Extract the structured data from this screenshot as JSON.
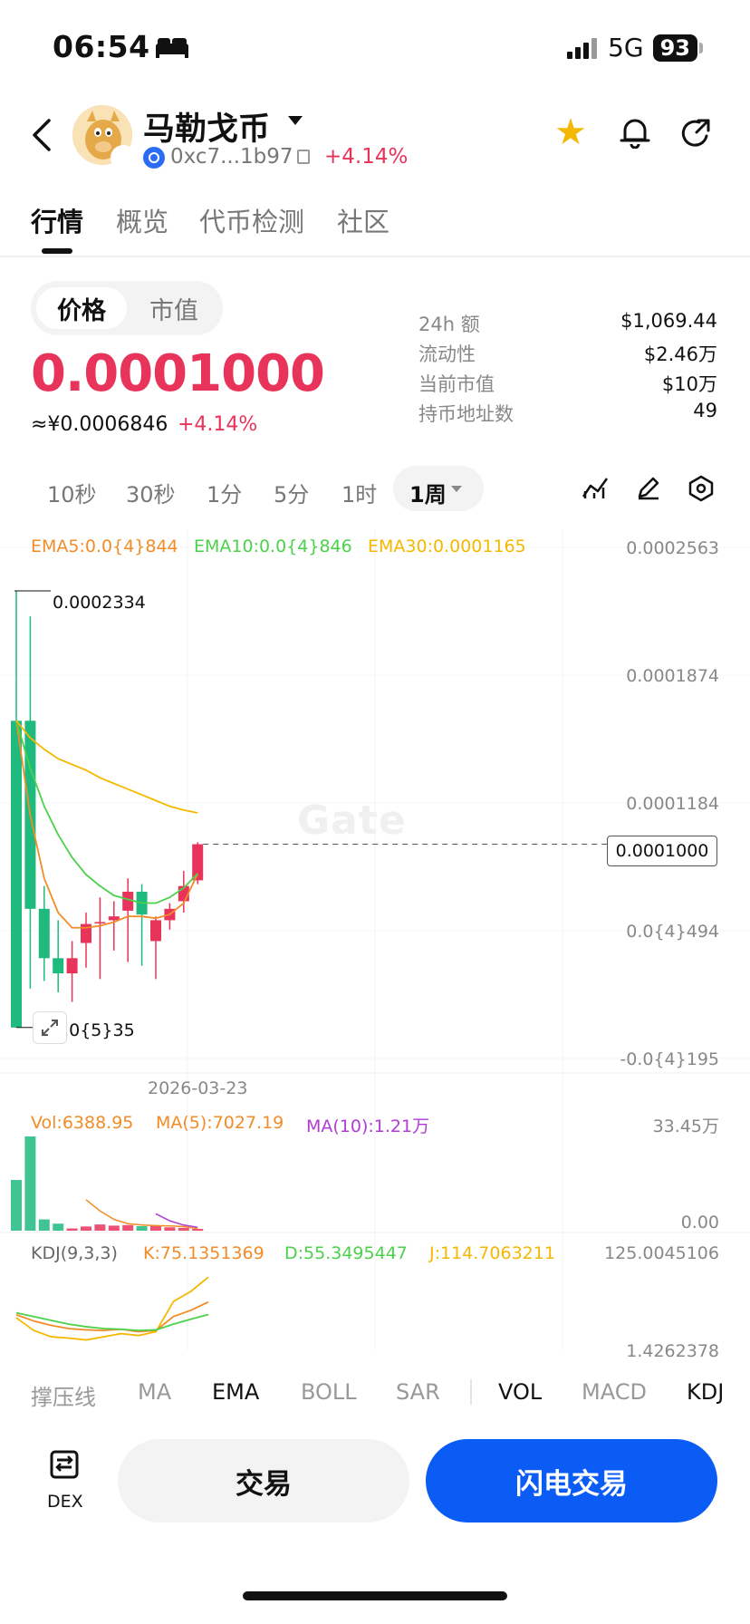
{
  "status_bar": {
    "time": "06:54",
    "network": "5G",
    "battery": "93"
  },
  "header": {
    "coin_name": "马勒戈币",
    "address": "0xc7...1b97",
    "change": "+4.14%"
  },
  "tabs": [
    "行情",
    "概览",
    "代币检测",
    "社区"
  ],
  "price_toggle": {
    "price": "价格",
    "market_cap": "市值"
  },
  "price": {
    "main": "0.0001000",
    "cny": "≈¥0.0006846",
    "change": "+4.14%"
  },
  "stats": [
    {
      "label": "24h  额",
      "value": "$1,069.44"
    },
    {
      "label": "流动性",
      "value": "$2.46万"
    },
    {
      "label": "当前市值",
      "value": "$10万"
    },
    {
      "label": "持币地址数",
      "value": "49"
    }
  ],
  "timeframes": [
    "10秒",
    "30秒",
    "1分",
    "5分",
    "1时"
  ],
  "active_timeframe": "1周",
  "chart": {
    "watermark": "Gate",
    "ema": {
      "ema5": "EMA5:0.0{4}844",
      "ema10": "EMA10:0.0{4}846",
      "ema30": "EMA30:0.0001165"
    },
    "y_axis": [
      "0.0002563",
      "0.0001874",
      "0.0001184",
      "0.0{4}494",
      "-0.0{4}195"
    ],
    "current_price_tag": "0.0001000",
    "high_label": "0.0002334",
    "low_label": "0.0{5}35",
    "date_label": "2026-03-23",
    "volume": {
      "vol": "Vol:6388.95",
      "ma5": "MA(5):7027.19",
      "ma10": "MA(10):1.21万",
      "axis_top": "33.45万",
      "axis_bottom": "0.00"
    },
    "kdj": {
      "title": "KDJ(9,3,3)",
      "k": "K:75.1351369",
      "d": "D:55.3495447",
      "j": "J:114.7063211",
      "axis_top": "125.0045106",
      "axis_bottom": "1.4262378"
    },
    "colors": {
      "up": "#e8345a",
      "down": "#1fba7e",
      "ema5": "#f28c28",
      "ema10": "#4cd14c",
      "ema30": "#f5b800",
      "ma10": "#b23bd6"
    }
  },
  "chart_data": {
    "type": "candlestick",
    "title": "",
    "ylabel": "",
    "xlabel": "",
    "ylim": [
      -1.95e-05,
      0.0002563
    ],
    "candles": [
      {
        "open": 0.000165,
        "high": 0.0002334,
        "low": 3.5e-06,
        "close": 3.5e-06
      },
      {
        "open": 0.000165,
        "high": 0.00022,
        "low": 2.4e-05,
        "close": 6.6e-05
      },
      {
        "open": 6.6e-05,
        "high": 7.8e-05,
        "low": 2.8e-05,
        "close": 4e-05
      },
      {
        "open": 4e-05,
        "high": 6e-05,
        "low": 2.2e-05,
        "close": 3.2e-05
      },
      {
        "open": 3.2e-05,
        "high": 4.9e-05,
        "low": 1.7e-05,
        "close": 4e-05
      },
      {
        "open": 4.8e-05,
        "high": 6.4e-05,
        "low": 3.5e-05,
        "close": 5.8e-05
      },
      {
        "open": 5.9e-05,
        "high": 7.2e-05,
        "low": 2.9e-05,
        "close": 5.9e-05
      },
      {
        "open": 6e-05,
        "high": 7e-05,
        "low": 4.4e-05,
        "close": 6.2e-05
      },
      {
        "open": 6.5e-05,
        "high": 8.2e-05,
        "low": 3.8e-05,
        "close": 7.5e-05
      },
      {
        "open": 7.5e-05,
        "high": 7.9e-05,
        "low": 3.6e-05,
        "close": 6.3e-05
      },
      {
        "open": 4.9e-05,
        "high": 6.2e-05,
        "low": 2.9e-05,
        "close": 6e-05
      },
      {
        "open": 6e-05,
        "high": 6.9e-05,
        "low": 5.5e-05,
        "close": 6.6e-05
      },
      {
        "open": 7e-05,
        "high": 8.6e-05,
        "low": 6.4e-05,
        "close": 7.8e-05
      },
      {
        "open": 8.1e-05,
        "high": 0.000101,
        "low": 7.9e-05,
        "close": 0.0001
      }
    ],
    "series": [
      {
        "name": "EMA5",
        "values": [
          0.000165,
          0.000115,
          8.2e-05,
          6.4e-05,
          5.6e-05,
          5.6e-05,
          5.7e-05,
          5.9e-05,
          6.2e-05,
          6.2e-05,
          6.1e-05,
          6.3e-05,
          6.9e-05,
          8.44e-05
        ]
      },
      {
        "name": "EMA10",
        "values": [
          0.000165,
          0.00014,
          0.00012,
          0.000105,
          9.3e-05,
          8.4e-05,
          7.8e-05,
          7.3e-05,
          7.1e-05,
          6.9e-05,
          6.9e-05,
          7.2e-05,
          7.7e-05,
          8.46e-05
        ]
      },
      {
        "name": "EMA30",
        "values": [
          0.000165,
          0.000156,
          0.00015,
          0.000145,
          0.000142,
          0.000139,
          0.000135,
          0.000132,
          0.000129,
          0.000126,
          0.000123,
          0.00012,
          0.000118,
          0.0001165
        ]
      }
    ],
    "volume": [
      180000,
      334500,
      40000,
      25000,
      8000,
      15000,
      22000,
      18000,
      20000,
      16000,
      19000,
      12000,
      10000,
      6388.95
    ],
    "vol_ma5": [
      null,
      null,
      null,
      null,
      null,
      110000,
      70000,
      40000,
      25000,
      20000,
      18000,
      17000,
      15000,
      7027.19
    ],
    "vol_ma10": [
      null,
      null,
      null,
      null,
      null,
      null,
      null,
      null,
      null,
      null,
      60000,
      35000,
      20000,
      12100
    ],
    "kdj_ylim": [
      1.4262378,
      125.0045106
    ],
    "kdj": {
      "k": [
        55,
        45,
        38,
        33,
        31,
        30,
        32,
        28,
        30,
        52,
        62,
        75.1351369
      ],
      "d": [
        58,
        52,
        46,
        40,
        36,
        33,
        32,
        30,
        31,
        40,
        48,
        55.3495447
      ],
      "j": [
        50,
        30,
        20,
        18,
        15,
        20,
        25,
        22,
        28,
        76,
        92,
        114.7063211
      ]
    }
  },
  "indicators": {
    "main": [
      "撑压线",
      "MA",
      "EMA",
      "BOLL",
      "SAR"
    ],
    "sub": [
      "VOL",
      "MACD",
      "KDJ"
    ],
    "selected": [
      "EMA",
      "VOL",
      "KDJ"
    ]
  },
  "bottom": {
    "dex_label": "DEX",
    "trade": "交易",
    "flash_trade": "闪电交易"
  }
}
